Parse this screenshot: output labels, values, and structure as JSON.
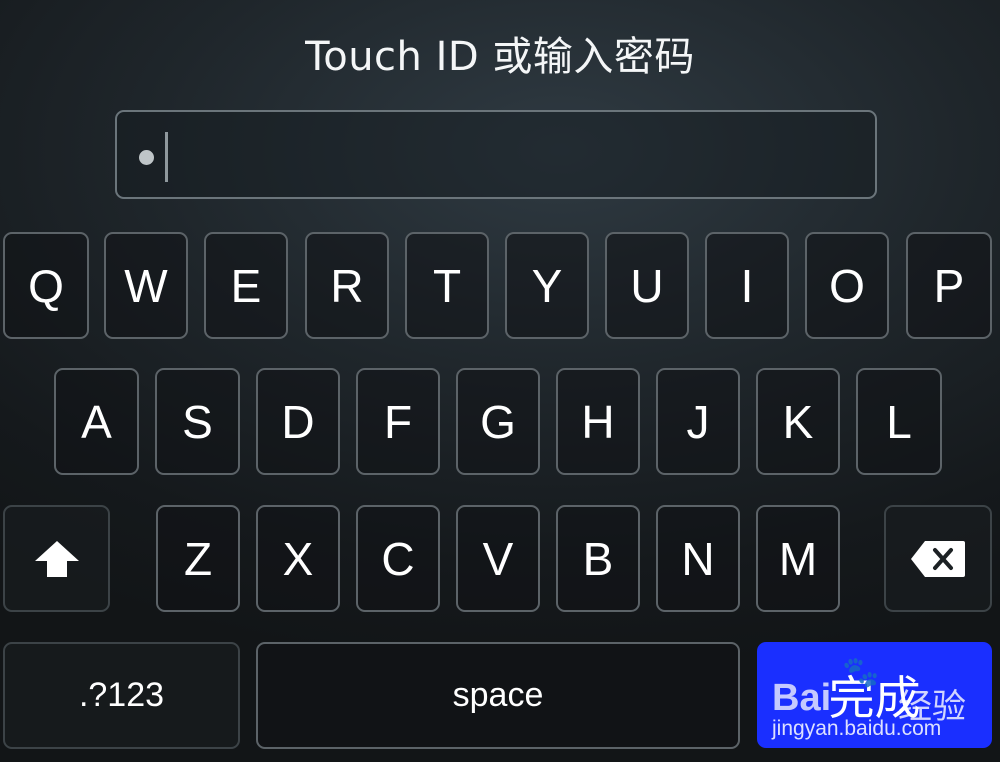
{
  "prompt": {
    "title": "Touch ID 或输入密码"
  },
  "password_field": {
    "masked_characters": 1
  },
  "keyboard": {
    "row1": [
      "Q",
      "W",
      "E",
      "R",
      "T",
      "Y",
      "U",
      "I",
      "O",
      "P"
    ],
    "row2": [
      "A",
      "S",
      "D",
      "F",
      "G",
      "H",
      "J",
      "K",
      "L"
    ],
    "row3": [
      "Z",
      "X",
      "C",
      "V",
      "B",
      "N",
      "M"
    ],
    "shift": {
      "icon": "shift-arrow-icon"
    },
    "backspace": {
      "icon": "backspace-icon"
    },
    "numbers_label": ".?123",
    "space_label": "space",
    "go_label": "完成"
  },
  "watermark": {
    "brand": "Bai",
    "brand_cn": "经验",
    "url": "jingyan.baidu.com",
    "icon": "paw-icon"
  },
  "colors": {
    "go_key": "#1a2fff",
    "key_border": "#5c6368",
    "background": "#1f262b"
  }
}
